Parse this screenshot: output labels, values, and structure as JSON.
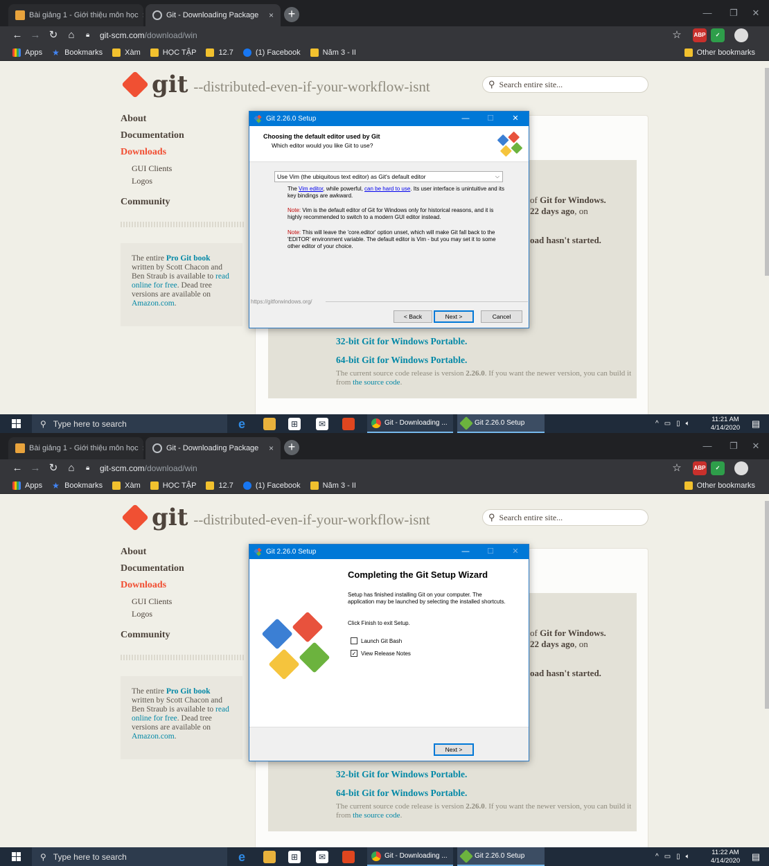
{
  "browser": {
    "tabs": [
      {
        "label": "Bài giảng 1 - Giới thiệu môn học"
      },
      {
        "label": "Git - Downloading Package"
      }
    ],
    "close_glyph": "×",
    "new_tab_glyph": "+",
    "url_host": "git-scm.com",
    "url_path": "/download/win",
    "bookmarks": [
      {
        "label": "Apps"
      },
      {
        "label": "Bookmarks"
      },
      {
        "label": "Xàm"
      },
      {
        "label": "HỌC TẬP"
      },
      {
        "label": "12.7"
      },
      {
        "label": "(1) Facebook"
      },
      {
        "label": "Năm 3 - II"
      }
    ],
    "other_bookmarks": "Other bookmarks",
    "abp_label": "ABP"
  },
  "site": {
    "logo_word": "git",
    "tagline": "--distributed-even-if-your-workflow-isnt",
    "search_placeholder": "Search entire site...",
    "nav": {
      "about": "About",
      "documentation": "Documentation",
      "downloads": "Downloads",
      "gui_clients": "GUI Clients",
      "logos": "Logos",
      "community": "Community"
    },
    "book": {
      "pre": "The entire ",
      "title": "Pro Git book",
      "mid": " written by Scott Chacon and Ben Straub is available to ",
      "read": "read online for free",
      "post": ". Dead tree versions are available on ",
      "amazon": "Amazon.com",
      "end": "."
    },
    "frag_line1_pre": "of ",
    "frag_line1_b": "Git for Windows.",
    "frag_line2_b": "22 days ago",
    "frag_line2_post": ", on",
    "frag_started": "oad hasn't started.",
    "portable32": "32-bit Git for Windows Portable.",
    "portable64": "64-bit Git for Windows Portable.",
    "note_pre": "The current source code release is version ",
    "note_version": "2.26.0",
    "note_mid": ". If you want the newer version, you can build it from ",
    "note_link": "the source code",
    "note_end": "."
  },
  "dialog1": {
    "title": "Git 2.26.0 Setup",
    "heading": "Choosing the default editor used by Git",
    "subheading": "Which editor would you like Git to use?",
    "selected_editor": "Use Vim (the ubiquitous text editor) as Git's default editor",
    "p1_a": "The ",
    "p1_link1": "Vim editor",
    "p1_b": ", while powerful, ",
    "p1_link2": "can be hard to use",
    "p1_c": ". Its user interface is unintuitive and its key bindings are awkward.",
    "p2_label": "Note:",
    "p2_text": " Vim is the default editor of Git for Windows only for historical reasons, and it is highly recommended to switch to a modern GUI editor instead.",
    "p3_label": "Note:",
    "p3_text": " This will leave the 'core.editor' option unset, which will make Git fall back to the 'EDITOR' environment variable. The default editor is Vim - but you may set it to some other editor of your choice.",
    "footer_url": "https://gitforwindows.org/",
    "back": "< Back",
    "next": "Next >",
    "cancel": "Cancel",
    "min_glyph": "—",
    "max_glyph": "☐",
    "close_glyph": "✕"
  },
  "dialog2": {
    "title": "Git 2.26.0 Setup",
    "heading": "Completing the Git Setup Wizard",
    "p1": "Setup has finished installing Git on your computer. The application may be launched by selecting the installed shortcuts.",
    "p2": "Click Finish to exit Setup.",
    "opt1": "Launch Git Bash",
    "opt1_checked": false,
    "opt2": "View Release Notes",
    "opt2_checked": true,
    "check_glyph": "✓",
    "next": "Next >"
  },
  "taskbar": {
    "search_placeholder": "Type here to search",
    "app1": "Git - Downloading ...",
    "app2": "Git 2.26.0 Setup",
    "tray_caret": "^",
    "clock1_time": "11:21 AM",
    "clock2_time": "11:22 AM",
    "date": "4/14/2020"
  },
  "colors": {
    "git_orange": "#f05033",
    "link_teal": "#0388a6",
    "win_blue": "#0078d7"
  }
}
